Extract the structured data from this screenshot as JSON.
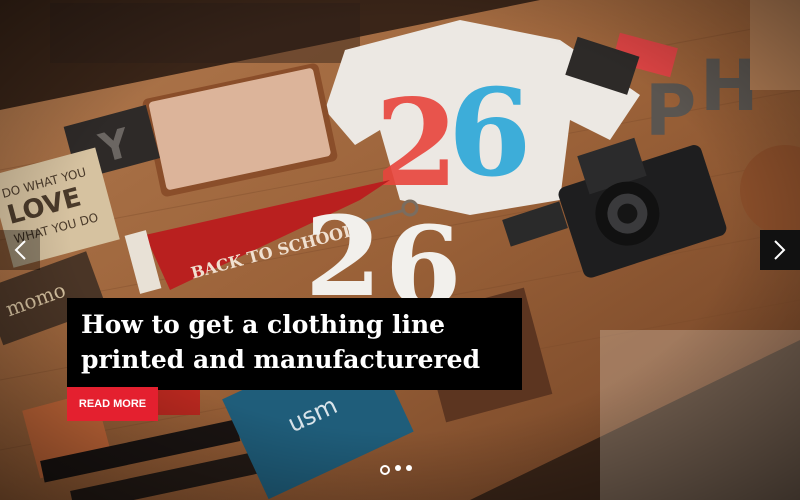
{
  "slide": {
    "headline_line1": "How to get a clothing line",
    "headline_line2": "printed and manufacturered",
    "button_label": "READ MORE"
  },
  "photo": {
    "tshirt_print": "26",
    "sticker_text": [
      "DO WHAT YOU",
      "LOVE",
      "WHAT YOU DO"
    ],
    "pennant_text": "BACK TO SCHOOL",
    "book_text": "usm"
  },
  "pagination": {
    "count": 3,
    "active_index": 0
  },
  "colors": {
    "accent": "#e4202f",
    "caption_bg": "#000000"
  }
}
